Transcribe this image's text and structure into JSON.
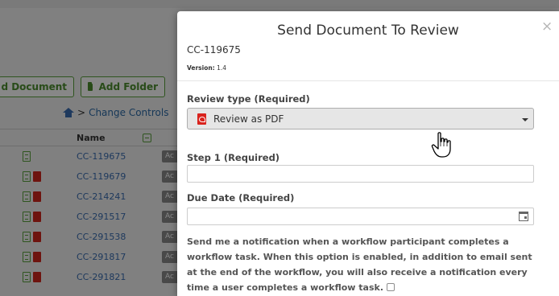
{
  "background": {
    "upload_button": "d Document",
    "add_folder_button": "Add Folder",
    "breadcrumb": {
      "separator": ">",
      "label": "Change Controls"
    },
    "table": {
      "column_name": "Name",
      "rows": [
        {
          "name": "CC-119675",
          "badge": "Ac",
          "pdf": false
        },
        {
          "name": "CC-119679",
          "badge": "Ac",
          "pdf": true
        },
        {
          "name": "CC-214241",
          "badge": "Ac",
          "pdf": true
        },
        {
          "name": "CC-291517",
          "badge": "Ac",
          "pdf": true
        },
        {
          "name": "CC-291538",
          "badge": "Ac",
          "pdf": true
        },
        {
          "name": "CC-291817",
          "badge": "Ac",
          "pdf": true
        },
        {
          "name": "CC-291821",
          "badge": "Ac",
          "pdf": true
        }
      ]
    }
  },
  "modal": {
    "title": "Send Document To Review",
    "close": "×",
    "document_code": "CC-119675",
    "version_label": "Version:",
    "version_value": "1.4",
    "review_type": {
      "label": "Review type (Required)",
      "selected": "Review as PDF"
    },
    "step1": {
      "label": "Step 1  (Required)",
      "value": ""
    },
    "due_date": {
      "label": "Due Date  (Required)",
      "value": ""
    },
    "notification_text": "Send me a notification when a workflow participant completes a workflow task. When this option is enabled, in addition to email sent at the end of the workflow, you will also receive a notification every time a user completes a workflow task.",
    "notification_checked": false
  },
  "colors": {
    "accent_green": "#5aa03c",
    "pdf_red": "#d9231d",
    "link_blue": "#3a6db0"
  },
  "icons": [
    "folder-icon",
    "home-icon",
    "doc-icon",
    "pdf-icon",
    "sort-icon",
    "close-icon",
    "chevron-down-icon",
    "calendar-icon",
    "hand-cursor-icon"
  ]
}
